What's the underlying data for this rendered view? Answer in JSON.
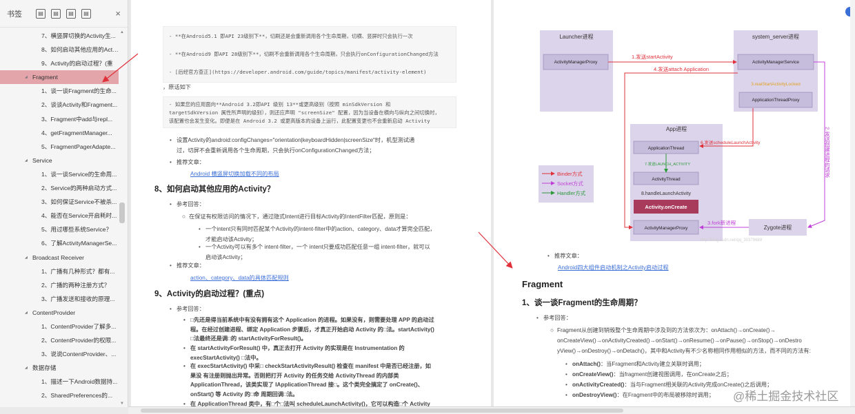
{
  "sidebar": {
    "title": "书签",
    "tools": [
      "▤",
      "▤",
      "▤",
      "▤"
    ],
    "close": "×",
    "items": [
      {
        "label": "7、横竖屏切换的Activity生...",
        "level": 2
      },
      {
        "label": "8、如何启动其他应用的Acti...",
        "level": 2
      },
      {
        "label": "9、Activity的启动过程？(重",
        "level": 2
      },
      {
        "label": "Fragment",
        "level": 1,
        "selected": true
      },
      {
        "label": "1、谈一谈Fragment的生命...",
        "level": 2
      },
      {
        "label": "2、谈谈Activity和Fragment...",
        "level": 2
      },
      {
        "label": "3、Fragment中add与repl...",
        "level": 2
      },
      {
        "label": "4、getFragmentManager...",
        "level": 2
      },
      {
        "label": "5、FragmentPagerAdapte...",
        "level": 2
      },
      {
        "label": "Service",
        "level": 1
      },
      {
        "label": "1、谈一谈Service的生命周...",
        "level": 2
      },
      {
        "label": "2、Service的两种启动方式...",
        "level": 2
      },
      {
        "label": "3、如何保证Service不被杀...",
        "level": 2
      },
      {
        "label": "4、能否在Service开启耗时...",
        "level": 2
      },
      {
        "label": "5、用过哪些系统Service？",
        "level": 2
      },
      {
        "label": "6、了解ActivityManagerSe...",
        "level": 2
      },
      {
        "label": "Broadcast Receiver",
        "level": 1
      },
      {
        "label": "1、广播有几种形式？都有...",
        "level": 2
      },
      {
        "label": "2、广播的两种注册方式？",
        "level": 2
      },
      {
        "label": "3、广播发送和接收的原理...",
        "level": 2
      },
      {
        "label": "ContentProvider",
        "level": 1
      },
      {
        "label": "1、ContentProvider了解多...",
        "level": 2
      },
      {
        "label": "2、ContentProvider的权限...",
        "level": 2
      },
      {
        "label": "3、说说ContentProvider、...",
        "level": 2
      },
      {
        "label": "数据存储",
        "level": 1
      },
      {
        "label": "1、描述一下Android数据持...",
        "level": 2
      },
      {
        "label": "2、SharedPreferences的...",
        "level": 2
      }
    ]
  },
  "left_page": {
    "code1": "- **在Android5.1 即API 23级别下**，切刷还是会重新调用各个生命周期，切横、竖屏时只会执行一次",
    "code2": "- **在Android9 即API 28级别下**，切刷不会重新调用各个生命周期，只会执行onConfigurationChanged方法",
    "code3": "- [后经官方查正](https://developer.android.com/guide/topics/manifest/activity-element)",
    "intro": "，原话如下",
    "code4a": "- 如果您的应用面向**Android 3.2即API 级别 13**或更高级别（按照 minSdkVersion 和",
    "code4b": "targetSdkVersion 属性所声明的级别），则还应声明 \"screenSize\" 配置，因为当设备在横向与纵向之间切换时，",
    "code4c": "该配置也会发生变化。即便是在 Android 3.2 或更高版本的设备上运行，此配置变更也不会重新启动 Activity",
    "tip1a": "设置Activity的android:configChanges=\"orientation|keyboardHidden|screenSize\"时，机型测试通",
    "tip1b": "过，切屏不会重新调用各个生命周期，只会执行onConfigurationChanged方法；",
    "rec_label": "推荐文章：",
    "rec_link1": "Android 横竖屏切换加载不同的布局",
    "h8": "8、如何启动其他应用的Activity？",
    "ref_label": "参考回答：",
    "p8": "在保证有权限访问的情况下，通过隐式Intent进行目标Activity的IntentFilter匹配，原则是：",
    "p8a1": "一个intent只有同时匹配某个Activity的intent-filter中的action、category、data才算完全匹配，",
    "p8a2": "才能启动该Activity；",
    "p8b1": "一个Activity可以有多个 intent-filter，一个 intent只要成功匹配任意一组 intent-filter，就可以",
    "p8b2": "启动该Activity；",
    "rec_link2": "action、category、data的具体匹配规则",
    "h9": "9、Activity的启动过程？(重点)",
    "p9a1": "□先还是得当前系统中有没有拥有这个 Application 的进程。如果没有，则需要处理 APP 的启动过",
    "p9a2": "程。在经过创建进程、绑定 Application 步骤后，才真正开始启动 Activity 的□法。startActivity()",
    "p9a3": "□法最终还是调□的 startActivityForResult()。",
    "p9b1": "在 startActivityForResult() 中，真正去打开 Activity 的实现是在 Instrumentation 的",
    "p9b2": "execStartActivity() □法中。",
    "p9c1": "在 execStartActivity() 中采□ checkStartActivityResult() 检查在 manifest 中是否已经注册，如",
    "p9c2": "果没 有注册则抛出异常。否则把打开 Activity 的任务交给 ActivityThread 的内部类",
    "p9c3": "ApplicationThread，该类实现了 IApplicationThread 接□。这个类完全搞定了 onCreate()、",
    "p9c4": "onStart() 等 Activity 的□命 周期回调□法。",
    "p9d1": "在 ApplicationThread 类中，有□个□法叫 scheduleLaunchActivity()，它可以构造□个 Activity"
  },
  "diagram": {
    "launcher": "Launcher进程",
    "amp": "ActivityManagerProxy",
    "system_server": "system_server进程",
    "ams": "ActivityManagerService",
    "realstart": "3.realStartActivityLocked",
    "atp": "ApplicationThreadProxy",
    "app": "App进程",
    "at": "ApplicationThread",
    "launch_msg": "7.发送LAUNCH_ACTIVITY",
    "activity_thread": "ActivityThread",
    "handle": "8.handleLaunchActivity",
    "oncreate": "Activity.onCreate",
    "amp2": "ActivityManagerProxy",
    "zygote": "Zygote进程",
    "s1": "1.发送startActivity",
    "s4": "4.发送attach Application",
    "s6": "6.发送scheduleLaunchActivity",
    "s2": "2.发送创建进程的请求",
    "s3": "3.fork新进程",
    "legend_binder": "Binder方式",
    "legend_socket": "Socket方式",
    "legend_handler": "Handler方式",
    "faint": "http://blog.csdn.net/qq_30379689"
  },
  "right_page": {
    "rec_label": "推荐文章：",
    "rec_link": "Android四大组件启动机制之Activity启动过程",
    "h_fragment": "Fragment",
    "h1": "1、谈一谈Fragment的生命周期？",
    "ref_label": "参考回答：",
    "p1a": "Fragment从创建到销毁整个生命周期中涉及到的方法依次为：onAttach()→onCreate()→",
    "p1b": "onCreateView()→onActivityCreated()→onStart()→onResume()→onPause()→onStop()→onDestro",
    "p1c": "yView()→onDestroy()→onDetach()，其中和Activity有不少名称相同作用相似的方法，而不同的方法有:",
    "li1_b": "onAttach()",
    "li1_t": "：当Fragment和Activity建立关联时调用；",
    "li2_b": "onCreateView()",
    "li2_t": "：当fragment创建视图调用，在onCreate之后；",
    "li3_b": "onActivityCreated()",
    "li3_t": "：当与Fragment相关联的Activity完成onCreate()之后调用；",
    "li4_b": "onDestroyView()",
    "li4_t": "：在Fragment中的布局被移除时调用；"
  },
  "watermark": "@稀土掘金技术社区",
  "colors": {
    "selected": "#e3a5aa",
    "link": "#3b6fd8",
    "arrow_red": "#e0303a",
    "diagram_purple": "#d8d0e8"
  }
}
